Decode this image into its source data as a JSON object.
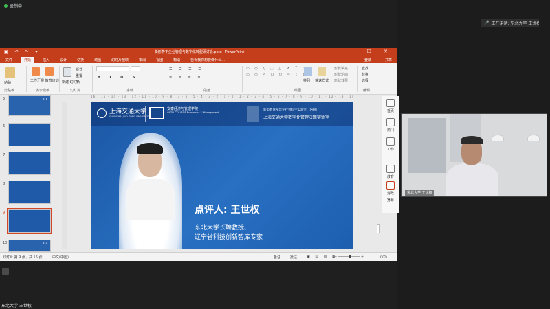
{
  "meeting": {
    "status_text": "录制中",
    "speaker_pill": "正在讲话: 东北大学 王世权",
    "bottom_text": "东北大学 王世权"
  },
  "ppt": {
    "title": "新形势下企业管理与数字化转型研讨会.pptx - PowerPoint",
    "menu": [
      "文件",
      "开始",
      "插入",
      "设计",
      "切换",
      "动画",
      "幻灯片放映",
      "审阅",
      "视图",
      "帮助"
    ],
    "search_hint": "告诉我你想要做什么...",
    "login": "登录",
    "share": "共享",
    "ribbon": {
      "paste": "粘贴",
      "clipboard": "剪贴板",
      "workbench": "工作汇报 教育培训",
      "templates": "演示模板",
      "new_slide": "新建\n幻灯片",
      "slides": "幻灯片",
      "layout": "版式",
      "reset": "重置",
      "section": "节",
      "font_group": "字体",
      "paragraph": "段落",
      "drawing": "绘图",
      "arrange": "排列",
      "quick_styles": "快速样式",
      "shape_fill": "形状填充",
      "shape_outline": "形状轮廓",
      "shape_effects": "形状效果",
      "find": "查找",
      "replace": "替换",
      "select": "选择",
      "editing": "编辑"
    },
    "ruler_text": "16 · 15 · 14 · 13 · 12 · 11 · 10 · 9 · 8 · 7 · 6 · 5 · 4 · 3 · 2 · 1 · 0 · 1 · 2 · 3 · 4 · 5 · 6 · 7 · 8 · 9 · 10 · 11 · 12 · 13 · 14 · 15 · 16",
    "thumbnails": [
      "5",
      "6",
      "7",
      "8",
      "9",
      "10"
    ],
    "thumb_badges": {
      "5": "01",
      "10": "02"
    },
    "statusbar": {
      "slide_info": "幻灯片 第 9 张，共 15 张",
      "language": "中文(中国)",
      "notes": "备注",
      "comments": "批注",
      "zoom": "77%"
    }
  },
  "slide": {
    "sjtu_name": "上海交通大学",
    "sjtu_en": "SHANGHAI JIAO TONG UNIVERSITY",
    "antai_cn": "安泰经济与管理学院",
    "antai_en": "ANTAI COLLEGE\nEconomics & Management",
    "lab_line1": "新型教育部哲学社会科学实验室（培育）",
    "lab_line2": "上海交通大学数字化管理决策实验室",
    "reviewer": "点评人: 王世权",
    "line1": "东北大学长聘教授、",
    "line2": "辽宁省科技创新智库专家"
  },
  "sidebar": {
    "items": [
      "首页",
      "热门",
      "工作",
      "教育",
      "党政",
      "宽幕"
    ]
  },
  "video": {
    "label": "东北大学 王世权"
  },
  "colors": {
    "ppt_accent": "#c43e1c",
    "slide_blue": "#1b57a5"
  }
}
